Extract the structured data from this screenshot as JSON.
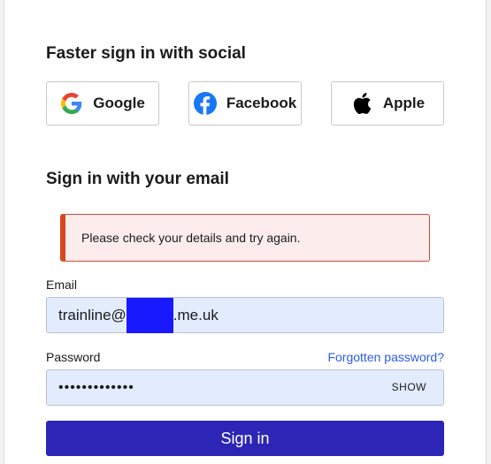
{
  "social": {
    "heading": "Faster sign in with social",
    "buttons": [
      {
        "label": "Google",
        "icon": "google-icon"
      },
      {
        "label": "Facebook",
        "icon": "facebook-icon"
      },
      {
        "label": "Apple",
        "icon": "apple-icon"
      }
    ]
  },
  "email_section": {
    "heading": "Sign in with your email",
    "error": "Please check your details and try again."
  },
  "form": {
    "email_label": "Email",
    "email_value_start": "trainline@",
    "email_value_end": ".me.uk",
    "password_label": "Password",
    "forgot_link": "Forgotten password?",
    "password_value": "•••••••••••••",
    "show_toggle": "SHOW",
    "submit_label": "Sign in"
  },
  "colors": {
    "primary_button": "#2c25b5",
    "link": "#2d5be0",
    "error_accent": "#d9451d",
    "error_bg": "#fcecec",
    "input_bg": "#e2ecfd",
    "facebook": "#1877f2"
  }
}
